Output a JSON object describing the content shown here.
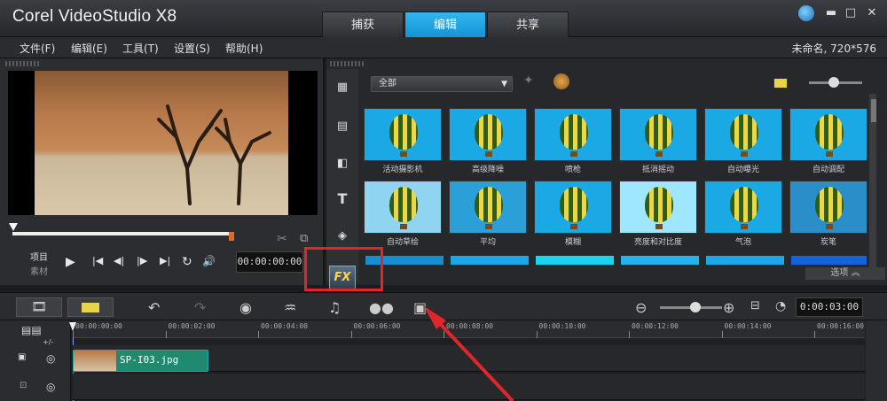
{
  "app": {
    "title": "Corel VideoStudio X8"
  },
  "tabs": [
    {
      "label": "捕获"
    },
    {
      "label": "编辑"
    },
    {
      "label": "共享"
    }
  ],
  "window_controls": {
    "min": "▬",
    "max": "□",
    "close": "✕"
  },
  "menu": [
    {
      "label": "文件(F)"
    },
    {
      "label": "编辑(E)"
    },
    {
      "label": "工具(T)"
    },
    {
      "label": "设置(S)"
    },
    {
      "label": "帮助(H)"
    }
  ],
  "project_info": "未命名, 720*576",
  "player": {
    "mode_project": "项目",
    "mode_clip": "素材",
    "timecode": "00:00:00:00",
    "controls": [
      "▶",
      "|◀",
      "◀|",
      "|▶",
      "▶|",
      "↻",
      "🔊"
    ]
  },
  "library": {
    "filter": "全部",
    "fx_label": "FX",
    "options": "选项",
    "items": [
      {
        "label": "活动摄影机",
        "bg": "#1aa9e4"
      },
      {
        "label": "高级降噪",
        "bg": "#1aa9e4"
      },
      {
        "label": "喷枪",
        "bg": "#1aa9e4"
      },
      {
        "label": "抵消摇动",
        "bg": "#1aa9e4"
      },
      {
        "label": "自动曝光",
        "bg": "#1aa9e4"
      },
      {
        "label": "自动调配",
        "bg": "#1aa9e4"
      },
      {
        "label": "自动草绘",
        "bg": "#8fd5f2"
      },
      {
        "label": "平均",
        "bg": "#2ba0d8"
      },
      {
        "label": "模糊",
        "bg": "#1aa9e4"
      },
      {
        "label": "亮度和对比度",
        "bg": "#9fe6ff"
      },
      {
        "label": "气泡",
        "bg": "#1aa9e4"
      },
      {
        "label": "炭笔",
        "bg": "#2a8fc8"
      }
    ]
  },
  "timeline": {
    "zoom_timecode": "0:00:03:00",
    "ruler": [
      "00:00:00:00",
      "00:00:02:00",
      "00:00:04:00",
      "00:00:06:00",
      "00:00:08:00",
      "00:00:10:00",
      "00:00:12:00",
      "00:00:14:00",
      "00:00:16:00"
    ],
    "clip_name": "SP-I03.jpg",
    "track_add_label": "+/-"
  }
}
